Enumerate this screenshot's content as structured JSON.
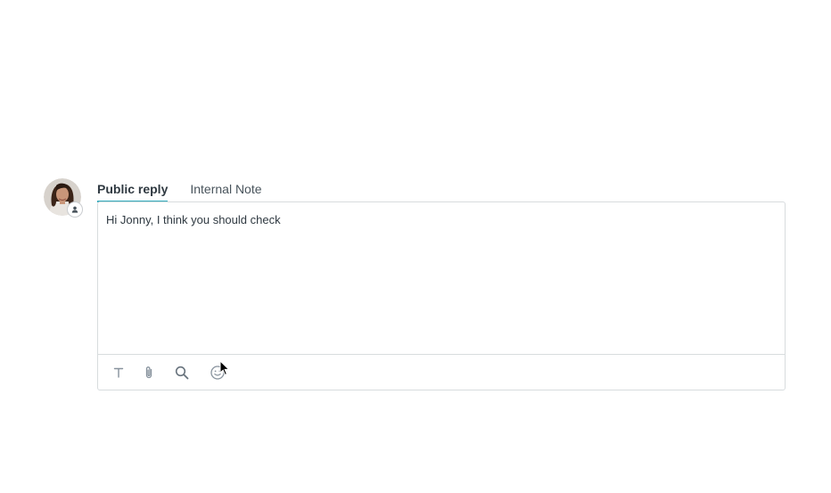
{
  "composer": {
    "tabs": [
      {
        "label": "Public reply",
        "active": true
      },
      {
        "label": "Internal Note",
        "active": false
      }
    ],
    "text": "Hi Jonny, I think you should check"
  },
  "toolbar": {
    "icons": [
      "text-format-icon",
      "attachment-icon",
      "search-icon",
      "emoji-icon"
    ]
  },
  "colors": {
    "active_tab_underline": "#30aabc",
    "border": "#d8dcde",
    "icon": "#87929d"
  }
}
